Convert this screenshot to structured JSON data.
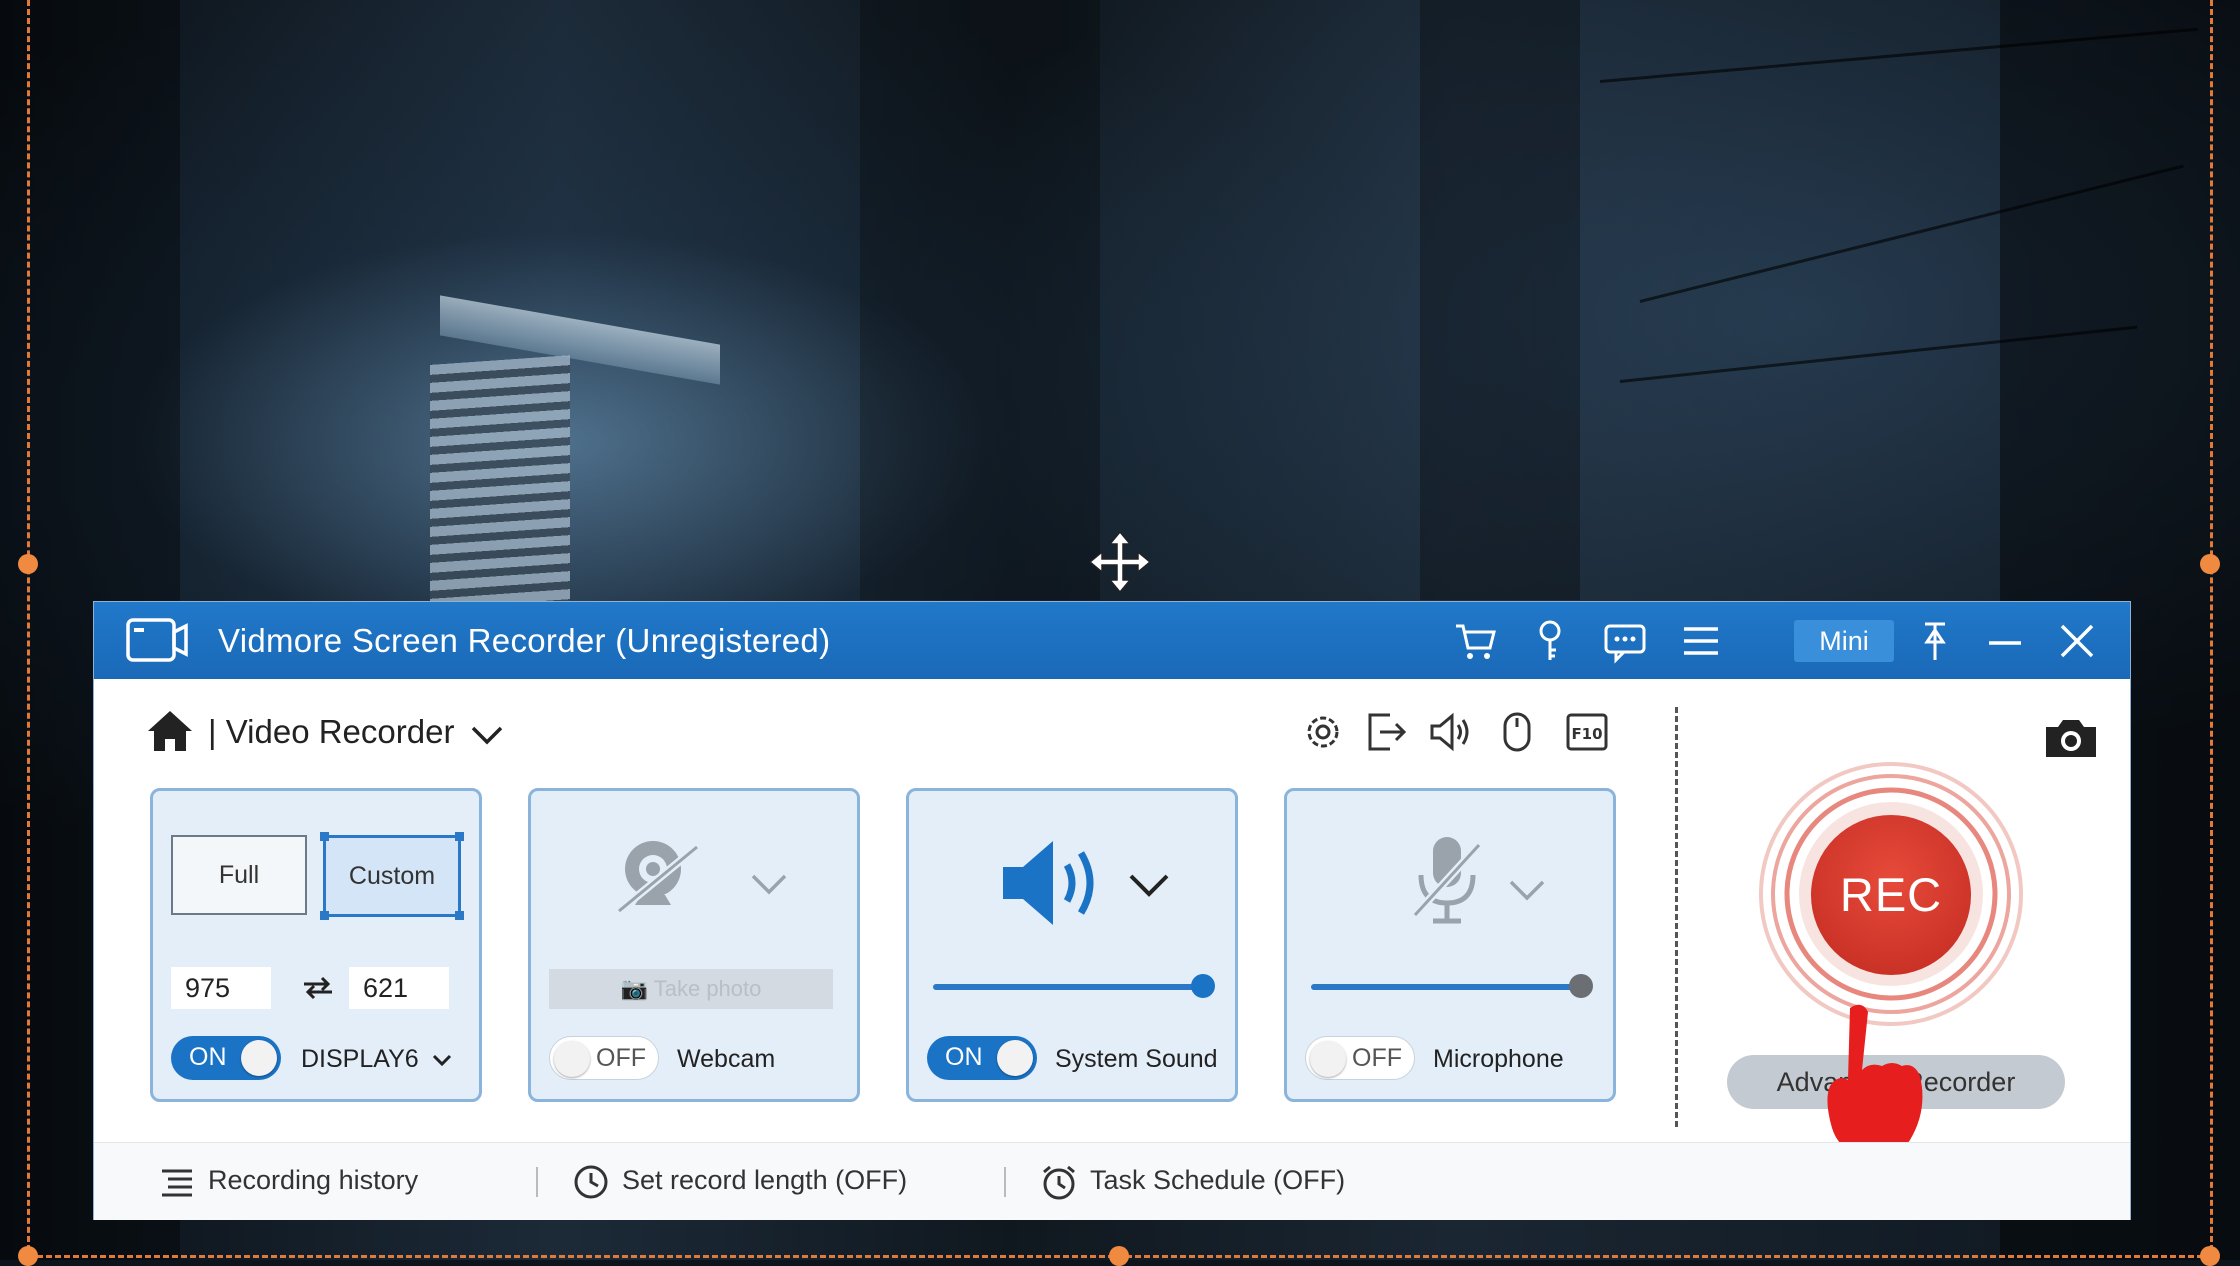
{
  "window": {
    "title": "Vidmore Screen Recorder (Unregistered)",
    "mini_label": "Mini"
  },
  "mode": {
    "label": "| Video Recorder"
  },
  "display_panel": {
    "full_label": "Full",
    "custom_label": "Custom",
    "width_value": "975",
    "height_value": "621",
    "toggle_label": "ON",
    "display_select": "DISPLAY6"
  },
  "webcam_panel": {
    "take_photo_label": "Take photo",
    "toggle_label": "OFF",
    "label": "Webcam"
  },
  "system_sound_panel": {
    "toggle_label": "ON",
    "label": "System Sound",
    "volume": 1.0
  },
  "microphone_panel": {
    "toggle_label": "OFF",
    "label": "Microphone",
    "volume": 1.0
  },
  "record": {
    "rec_label": "REC",
    "advanced_label": "Advanced Recorder"
  },
  "status_bar": {
    "history_label": "Recording history",
    "length_label": "Set record length (OFF)",
    "schedule_label": "Task Schedule (OFF)"
  },
  "colors": {
    "titlebar": "#1a69b8",
    "accent": "#2b78c6",
    "rec": "#d3362a",
    "selection": "#e07a3a"
  }
}
